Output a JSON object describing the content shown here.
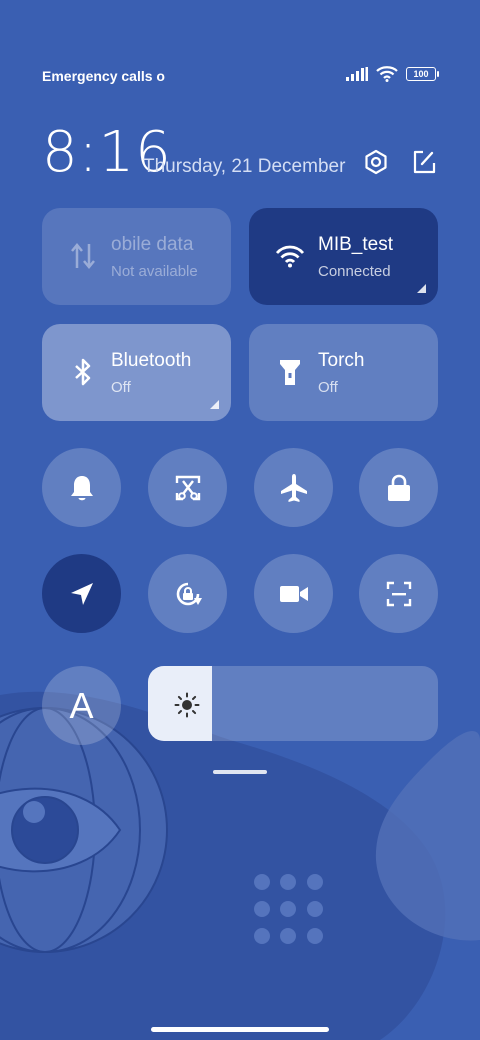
{
  "status_bar": {
    "carrier_text": "Emergency calls o",
    "battery": "100"
  },
  "header": {
    "time": "8:16",
    "date": "Thursday, 21 December"
  },
  "tiles": {
    "mobile_data": {
      "title": "obile data",
      "subtitle": "Not available"
    },
    "wifi": {
      "title": "MIB_test",
      "subtitle": "Connected"
    },
    "bluetooth": {
      "title": "Bluetooth",
      "subtitle": "Off"
    },
    "torch": {
      "title": "Torch",
      "subtitle": "Off"
    }
  },
  "reading_mode_letter": "A",
  "brightness": {
    "level": 0.22
  },
  "colors": {
    "background": "#3a5fb2",
    "active_toggle": "#1f3a84",
    "tile_inactive": "rgba(255,255,255,0.2)"
  },
  "icons": [
    "signal-icon",
    "wifi-icon",
    "battery-icon",
    "settings-icon",
    "edit-icon",
    "mobile-data-icon",
    "bluetooth-icon",
    "torch-icon",
    "bell-icon",
    "screenshot-icon",
    "airplane-icon",
    "lock-icon",
    "location-icon",
    "rotation-lock-icon",
    "video-camera-icon",
    "scanner-icon",
    "brightness-sun-icon"
  ]
}
